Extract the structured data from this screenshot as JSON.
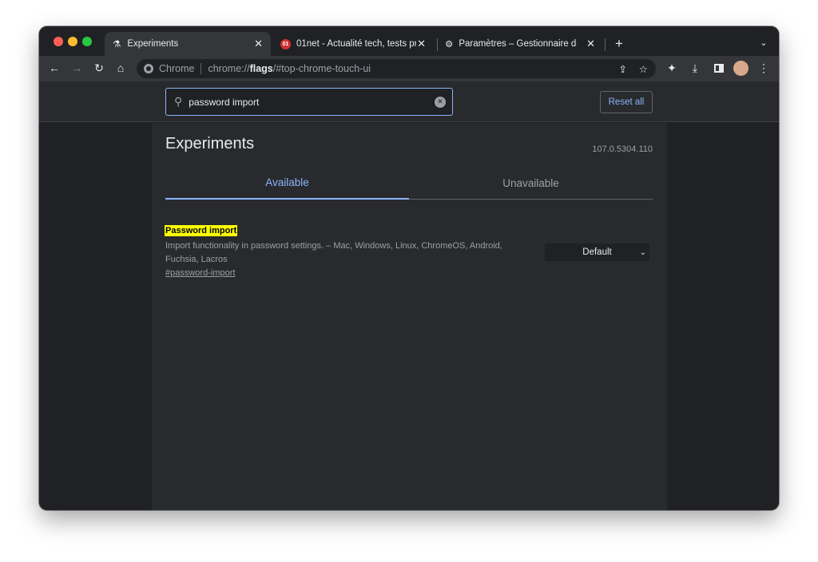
{
  "tabs": [
    {
      "title": "Experiments",
      "icon": "flask-icon",
      "active": true
    },
    {
      "title": "01net - Actualité tech, tests pr",
      "icon": "01net-favicon"
    },
    {
      "title": "Paramètres – Gestionnaire de m",
      "icon": "gear-icon"
    }
  ],
  "omnibox": {
    "site_label": "Chrome",
    "url_prefix": "chrome://",
    "url_bold": "flags",
    "url_suffix": "/#top-chrome-touch-ui"
  },
  "search": {
    "value": "password import"
  },
  "reset_label": "Reset all",
  "page": {
    "title": "Experiments",
    "version": "107.0.5304.110",
    "tabs": [
      "Available",
      "Unavailable"
    ]
  },
  "flag": {
    "name": "Password import",
    "description": "Import functionality in password settings. – Mac, Windows, Linux, ChromeOS, Android, Fuchsia, Lacros",
    "link": "#password-import",
    "select_value": "Default"
  },
  "colors": {
    "accent": "#8ab4f8",
    "highlight": "#ffff00"
  }
}
